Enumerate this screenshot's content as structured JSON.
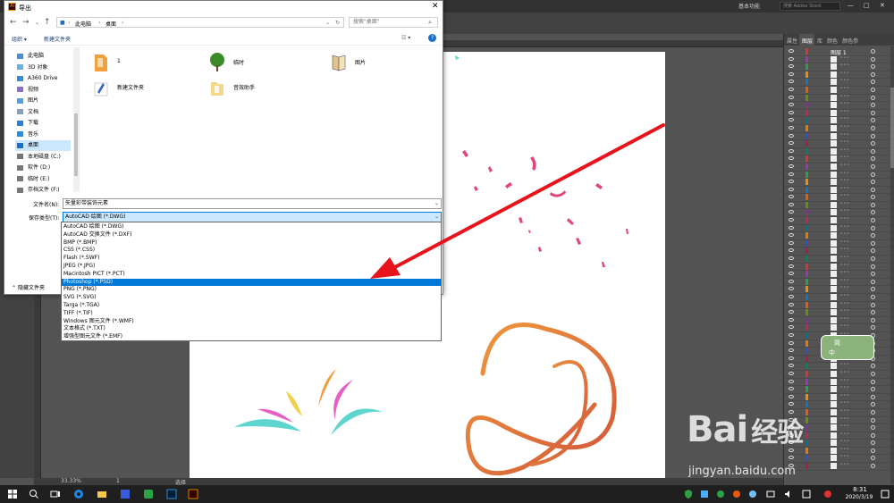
{
  "illustrator": {
    "workspace": "基本功能",
    "search_placeholder": "搜索 Adobe Stock",
    "status": {
      "zoom": "33.33%",
      "page": "1",
      "tool": "选择"
    },
    "panel_tabs": [
      "属性",
      "图层",
      "库",
      "颜色",
      "颜色参"
    ],
    "layer_name": "图层 1",
    "widget_text_1": "简",
    "widget_text_2": "中"
  },
  "dialog": {
    "title": "导出",
    "address": [
      "此电脑",
      "桌面"
    ],
    "search_placeholder": "搜索\"桌面\"",
    "toolbar": {
      "organize": "组织",
      "new_folder": "新建文件夹"
    },
    "nav_items": [
      {
        "label": "此电脑",
        "icon": "computer-icon"
      },
      {
        "label": "3D 对象",
        "icon": "3d-objects-icon"
      },
      {
        "label": "A360 Drive",
        "icon": "cloud-drive-icon"
      },
      {
        "label": "视频",
        "icon": "video-folder-icon"
      },
      {
        "label": "图片",
        "icon": "pictures-folder-icon"
      },
      {
        "label": "文档",
        "icon": "documents-folder-icon"
      },
      {
        "label": "下载",
        "icon": "downloads-folder-icon"
      },
      {
        "label": "音乐",
        "icon": "music-folder-icon"
      },
      {
        "label": "桌面",
        "icon": "desktop-folder-icon",
        "selected": true
      },
      {
        "label": "本地磁盘 (C:)",
        "icon": "local-disk-icon"
      },
      {
        "label": "软件 (D:)",
        "icon": "drive-icon"
      },
      {
        "label": "临时 (E:)",
        "icon": "drive-icon"
      },
      {
        "label": "存档文件 (F:)",
        "icon": "drive-icon"
      }
    ],
    "files": [
      {
        "name": "1",
        "icon": "file-icon"
      },
      {
        "name": "临时",
        "icon": "tree-image-icon"
      },
      {
        "name": "图片",
        "icon": "book-icon"
      },
      {
        "name": "新建文件夹",
        "icon": "folder-icon"
      },
      {
        "name": "音效助手",
        "icon": "folder-icon"
      }
    ],
    "filename_label": "文件名(N):",
    "filename_value": "矢量彩带装饰元素",
    "filetype_label": "保存类型(T):",
    "filetype_value": "AutoCAD 绘图 (*.DWG)",
    "hide_folders": "隐藏文件夹",
    "filetype_options": [
      "AutoCAD 绘图 (*.DWG)",
      "AutoCAD 交换文件 (*.DXF)",
      "BMP (*.BMP)",
      "CSS (*.CSS)",
      "Flash (*.SWF)",
      "JPEG (*.JPG)",
      "Macintosh PICT (*.PCT)",
      "Photoshop (*.PSD)",
      "PNG (*.PNG)",
      "SVG (*.SVG)",
      "Targa (*.TGA)",
      "TIFF (*.TIF)",
      "Windows 图元文件 (*.WMF)",
      "文本格式 (*.TXT)",
      "增强型图元文件 (*.EMF)"
    ],
    "selected_option": "Photoshop (*.PSD)"
  },
  "taskbar": {
    "time": "8:31",
    "date": "2020/3/19"
  },
  "watermark": {
    "line1": "Bai",
    "line1b": "经验",
    "line2": "jingyan.baidu.com"
  },
  "colors": {
    "arrow": "#e8141c",
    "selection": "#0078d7",
    "ribbon_orange": "#e8733a",
    "confetti_pink": "#e0457b"
  }
}
